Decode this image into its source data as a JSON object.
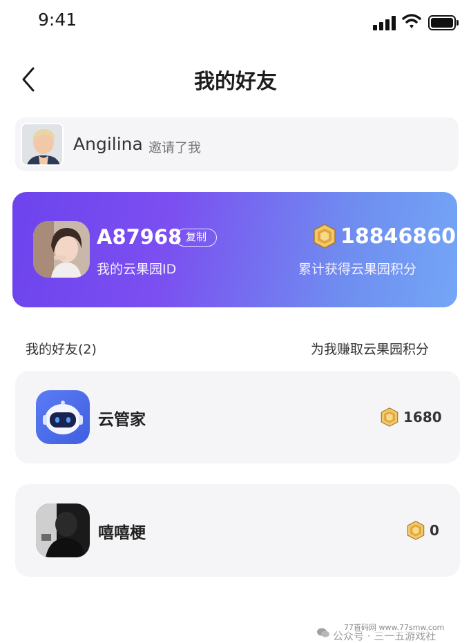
{
  "status_bar": {
    "time": "9:41"
  },
  "header": {
    "title": "我的好友"
  },
  "inviter": {
    "name": "Angilina",
    "action_text": "邀请了我"
  },
  "profile": {
    "id": "A87968",
    "copy_label": "复制",
    "id_label": "我的云果园ID",
    "points_total": "18846860",
    "points_label": "累计获得云果园积分"
  },
  "friends_section": {
    "title": "我的好友(2)",
    "subtitle": "为我赚取云果园积分"
  },
  "friends": [
    {
      "name": "云管家",
      "points": "1680",
      "avatar": "robot-avatar"
    },
    {
      "name": "嘻嘻梗",
      "points": "0",
      "avatar": "dark-photo-avatar"
    }
  ],
  "watermark": {
    "main": "公众号 · 三一五游戏社",
    "site": "77首码网 www.77smw.com"
  },
  "colors": {
    "card_gradient_start": "#6d43ee",
    "card_gradient_end": "#74a6f6",
    "coin_gold": "#e2b04c",
    "card_bg": "#f5f5f7"
  }
}
